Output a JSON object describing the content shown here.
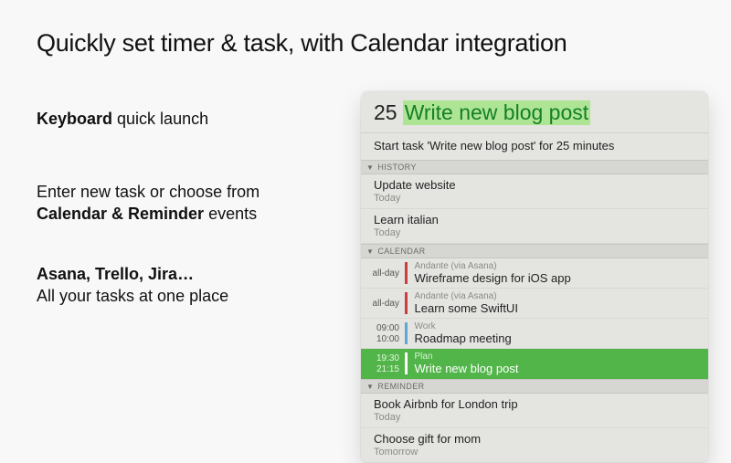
{
  "title": "Quickly set timer & task, with Calendar integration",
  "features": {
    "f1": {
      "bold": "Keyboard",
      "rest": " quick launch"
    },
    "f2": {
      "pre": "Enter new task or choose from",
      "bold": "Calendar & Reminder",
      "post": " events"
    },
    "f3": {
      "bold": "Asana, Trello, Jira…",
      "rest": "All your tasks at one place"
    }
  },
  "launcher": {
    "minutes": "25",
    "task": "Write new blog post",
    "description": "Start task 'Write new blog post' for 25 minutes"
  },
  "sections": {
    "history": {
      "label": "HISTORY",
      "items": [
        {
          "title": "Update website",
          "sub": "Today"
        },
        {
          "title": "Learn italian",
          "sub": "Today"
        }
      ]
    },
    "calendar": {
      "label": "CALENDAR",
      "items": [
        {
          "t1": "all-day",
          "t2": "",
          "color": "#c8403e",
          "cat": "Andante (via Asana)",
          "txt": "Wireframe design for iOS app",
          "selected": false
        },
        {
          "t1": "all-day",
          "t2": "",
          "color": "#c8403e",
          "cat": "Andante (via Asana)",
          "txt": "Learn some SwiftUI",
          "selected": false
        },
        {
          "t1": "09:00",
          "t2": "10:00",
          "color": "#5aa8d6",
          "cat": "Work",
          "txt": "Roadmap meeting",
          "selected": false
        },
        {
          "t1": "19:30",
          "t2": "21:15",
          "color": "#ffffff",
          "cat": "Plan",
          "txt": "Write new blog post",
          "selected": true
        }
      ]
    },
    "reminder": {
      "label": "REMINDER",
      "items": [
        {
          "title": "Book Airbnb for London trip",
          "sub": "Today"
        },
        {
          "title": "Choose gift for mom",
          "sub": "Tomorrow"
        }
      ]
    }
  }
}
